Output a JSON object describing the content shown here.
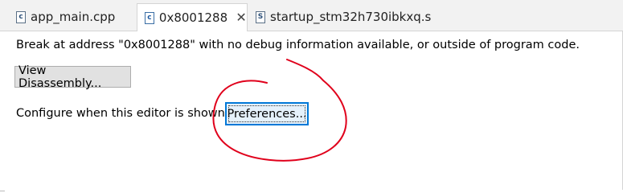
{
  "tabs": [
    {
      "label": "app_main.cpp",
      "icon": "cpp-file-icon",
      "active": false
    },
    {
      "label": "0x8001288",
      "icon": "c-file-icon",
      "active": true,
      "closable": true
    },
    {
      "label": "startup_stm32h730ibkxq.s",
      "icon": "s-file-icon",
      "active": false
    }
  ],
  "icons": {
    "cpp_letter": "c",
    "c_letter": "c",
    "s_letter": "S",
    "close": "✕"
  },
  "editor": {
    "message": "Break at address \"0x8001288\" with no debug information available, or outside of program code.",
    "view_disassembly_label": "View Disassembly...",
    "configure_label": "Configure when this editor is shown",
    "preferences_label": "Preferences..."
  },
  "colors": {
    "annotation_red": "#e0001b",
    "focus_blue": "#0078d7"
  }
}
